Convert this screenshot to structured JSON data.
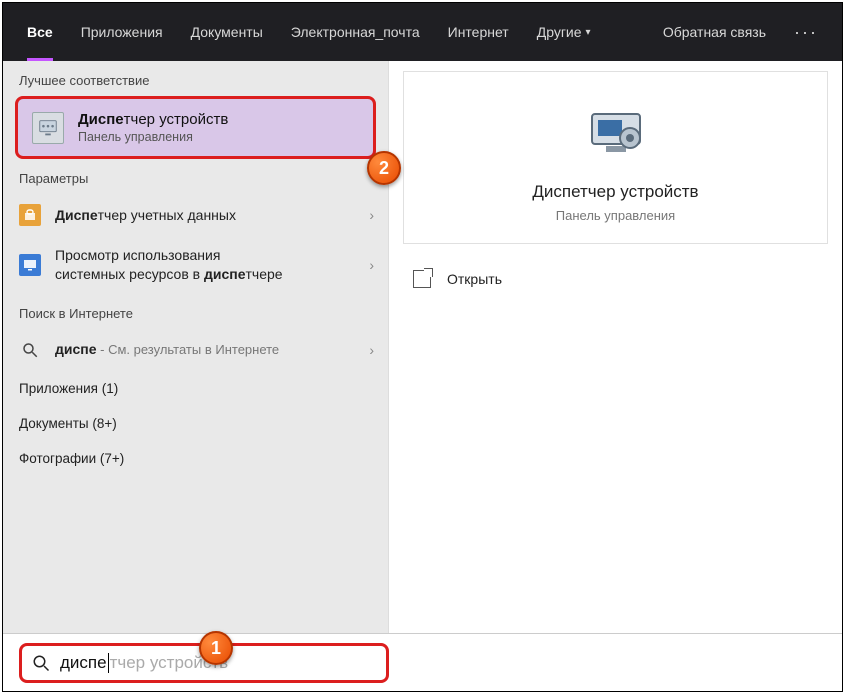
{
  "nav": {
    "tabs": [
      "Все",
      "Приложения",
      "Документы",
      "Электронная_почта",
      "Интернет",
      "Другие"
    ],
    "feedback": "Обратная связь"
  },
  "left": {
    "bestMatchLabel": "Лучшее соответствие",
    "bestMatch": {
      "titlePrefix": "Диспе",
      "titleRest": "тчер устройств",
      "subtitle": "Панель управления"
    },
    "settingsLabel": "Параметры",
    "settingsItems": [
      {
        "prefix": "Диспе",
        "rest": "тчер учетных данных"
      },
      {
        "line1": "Просмотр использования",
        "line2a": "системных ресурсов в ",
        "line2b": "диспе",
        "line2c": "тчере"
      }
    ],
    "webLabel": "Поиск в Интернете",
    "webQuery": "диспе",
    "webHint": " - См. результаты в Интернете",
    "categories": [
      "Приложения (1)",
      "Документы (8+)",
      "Фотографии (7+)"
    ]
  },
  "detail": {
    "title": "Диспетчер устройств",
    "subtitle": "Панель управления",
    "open": "Открыть"
  },
  "search": {
    "typed": "диспе",
    "ghost": "тчер устройств"
  },
  "badges": {
    "one": "1",
    "two": "2"
  }
}
